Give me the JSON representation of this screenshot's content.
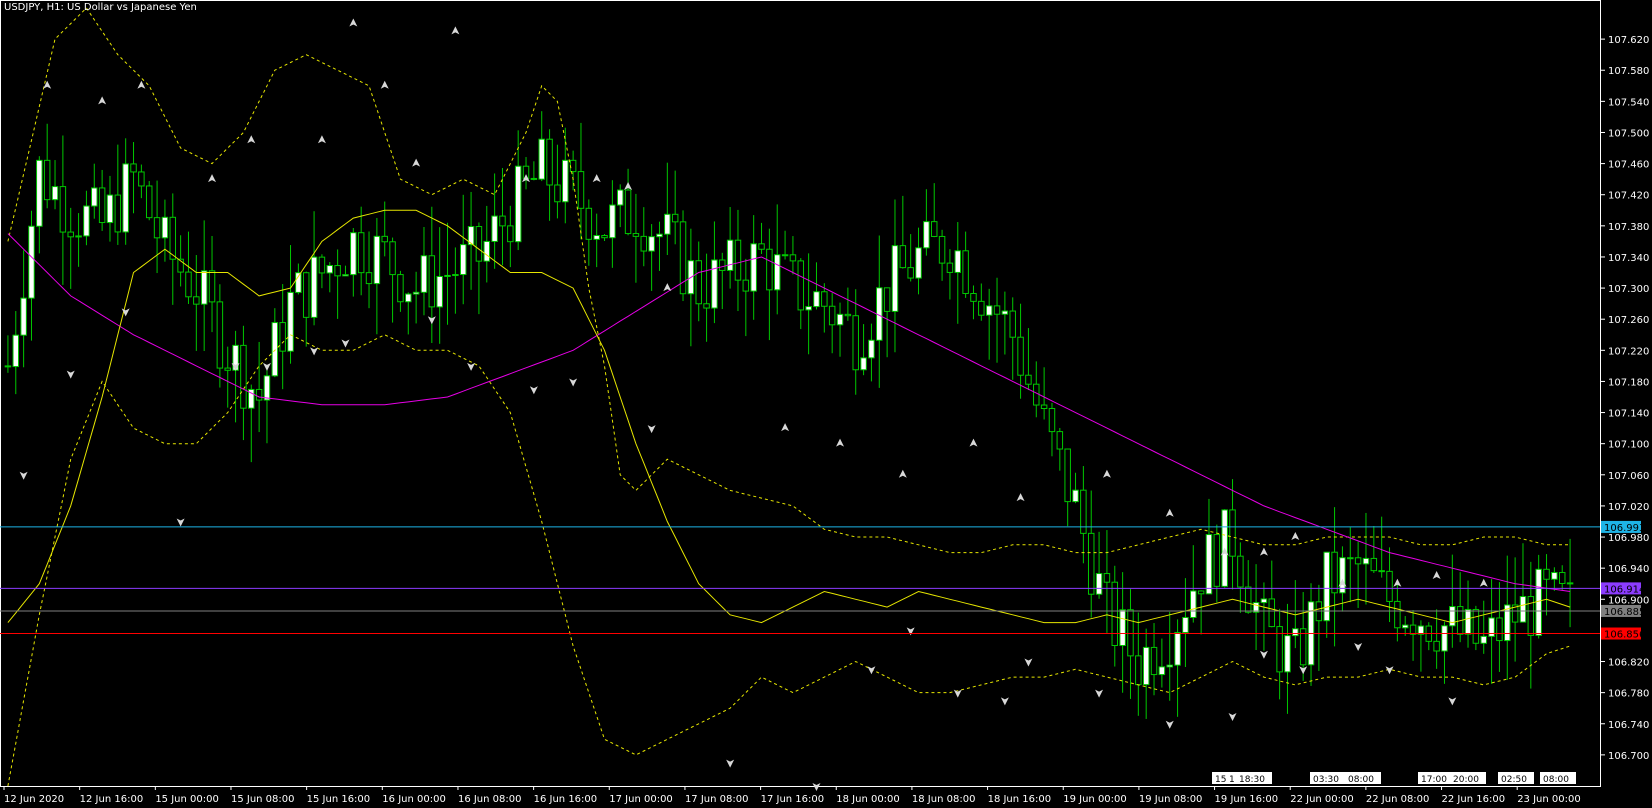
{
  "window": {
    "title": "USDJPY, H1:  US Dollar vs Japanese Yen"
  },
  "colors": {
    "background": "#000000",
    "bull_body": "#ffffff",
    "candle_line": "#00c800",
    "bear_body": "#000000",
    "fast_ma": "#e6e600",
    "slow_ma": "#e600e6",
    "bands": "#e6e600",
    "line_blue": "#1eb4e6",
    "line_purple": "#8c3cff",
    "line_gray": "#808080",
    "line_red": "#ff0000",
    "axis": "#ffffff"
  },
  "chart_data": {
    "type": "candlestick",
    "symbol": "USDJPY",
    "timeframe": "H1",
    "ylim": [
      106.66,
      107.66
    ],
    "y_ticks": [
      "107.620",
      "107.580",
      "107.540",
      "107.500",
      "107.460",
      "107.420",
      "107.380",
      "107.340",
      "107.300",
      "107.260",
      "107.220",
      "107.180",
      "107.140",
      "107.100",
      "107.060",
      "107.020",
      "106.980",
      "106.940",
      "106.900",
      "106.820",
      "106.780",
      "106.740",
      "106.700"
    ],
    "x_ticks": [
      "12 Jun 2020",
      "12 Jun 16:00",
      "15 Jun 00:00",
      "15 Jun 08:00",
      "15 Jun 16:00",
      "16 Jun 00:00",
      "16 Jun 08:00",
      "16 Jun 16:00",
      "17 Jun 00:00",
      "17 Jun 08:00",
      "17 Jun 16:00",
      "18 Jun 00:00",
      "18 Jun 08:00",
      "18 Jun 16:00",
      "19 Jun 00:00",
      "19 Jun 08:00",
      "19 Jun 16:00",
      "22 Jun 00:00",
      "22 Jun 08:00",
      "22 Jun 16:00",
      "23 Jun 00:00"
    ],
    "bar_count": 200,
    "horizontal_lines": [
      {
        "value": 106.993,
        "label": "106.993",
        "color": "#1eb4e6"
      },
      {
        "value": 106.914,
        "label": "106.914",
        "color": "#8c3cff"
      },
      {
        "value": 106.885,
        "label": "106.885",
        "color": "#808080"
      },
      {
        "value": 106.856,
        "label": "106.856",
        "color": "#ff0000"
      }
    ],
    "price_path": [
      [
        0,
        107.2
      ],
      [
        4,
        107.45
      ],
      [
        8,
        107.4
      ],
      [
        12,
        107.38
      ],
      [
        16,
        107.44
      ],
      [
        20,
        107.35
      ],
      [
        24,
        107.3
      ],
      [
        28,
        107.22
      ],
      [
        32,
        107.16
      ],
      [
        36,
        107.28
      ],
      [
        40,
        107.32
      ],
      [
        44,
        107.36
      ],
      [
        48,
        107.34
      ],
      [
        52,
        107.3
      ],
      [
        56,
        107.32
      ],
      [
        60,
        107.34
      ],
      [
        64,
        107.4
      ],
      [
        68,
        107.45
      ],
      [
        72,
        107.42
      ],
      [
        76,
        107.38
      ],
      [
        80,
        107.4
      ],
      [
        84,
        107.36
      ],
      [
        88,
        107.3
      ],
      [
        92,
        107.32
      ],
      [
        96,
        107.34
      ],
      [
        100,
        107.3
      ],
      [
        104,
        107.28
      ],
      [
        108,
        107.24
      ],
      [
        112,
        107.3
      ],
      [
        116,
        107.34
      ],
      [
        120,
        107.36
      ],
      [
        124,
        107.3
      ],
      [
        128,
        107.24
      ],
      [
        132,
        107.12
      ],
      [
        136,
        107.02
      ],
      [
        140,
        106.88
      ],
      [
        144,
        106.82
      ],
      [
        148,
        106.86
      ],
      [
        152,
        106.94
      ],
      [
        156,
        106.98
      ],
      [
        160,
        106.86
      ],
      [
        164,
        106.82
      ],
      [
        168,
        106.92
      ],
      [
        172,
        106.94
      ],
      [
        176,
        106.9
      ],
      [
        180,
        106.88
      ],
      [
        184,
        106.86
      ],
      [
        188,
        106.84
      ],
      [
        192,
        106.88
      ],
      [
        196,
        106.9
      ],
      [
        199,
        106.89
      ]
    ],
    "fast_ma_path": [
      [
        0,
        106.87
      ],
      [
        4,
        106.92
      ],
      [
        8,
        107.02
      ],
      [
        12,
        107.16
      ],
      [
        16,
        107.32
      ],
      [
        20,
        107.35
      ],
      [
        24,
        107.32
      ],
      [
        28,
        107.32
      ],
      [
        32,
        107.29
      ],
      [
        36,
        107.3
      ],
      [
        40,
        107.36
      ],
      [
        44,
        107.39
      ],
      [
        48,
        107.4
      ],
      [
        52,
        107.4
      ],
      [
        56,
        107.38
      ],
      [
        60,
        107.35
      ],
      [
        64,
        107.32
      ],
      [
        68,
        107.32
      ],
      [
        72,
        107.3
      ],
      [
        76,
        107.22
      ],
      [
        80,
        107.1
      ],
      [
        84,
        107.0
      ],
      [
        88,
        106.92
      ],
      [
        92,
        106.88
      ],
      [
        96,
        106.87
      ],
      [
        100,
        106.89
      ],
      [
        104,
        106.91
      ],
      [
        108,
        106.9
      ],
      [
        112,
        106.89
      ],
      [
        116,
        106.91
      ],
      [
        120,
        106.9
      ],
      [
        124,
        106.89
      ],
      [
        128,
        106.88
      ],
      [
        132,
        106.87
      ],
      [
        136,
        106.87
      ],
      [
        140,
        106.88
      ],
      [
        144,
        106.87
      ],
      [
        148,
        106.88
      ],
      [
        152,
        106.89
      ],
      [
        156,
        106.9
      ],
      [
        160,
        106.89
      ],
      [
        164,
        106.88
      ],
      [
        168,
        106.89
      ],
      [
        172,
        106.9
      ],
      [
        176,
        106.89
      ],
      [
        180,
        106.88
      ],
      [
        184,
        106.87
      ],
      [
        188,
        106.88
      ],
      [
        192,
        106.89
      ],
      [
        196,
        106.9
      ],
      [
        199,
        106.89
      ]
    ],
    "slow_ma_path": [
      [
        0,
        107.37
      ],
      [
        8,
        107.29
      ],
      [
        16,
        107.24
      ],
      [
        24,
        107.2
      ],
      [
        32,
        107.16
      ],
      [
        40,
        107.15
      ],
      [
        48,
        107.15
      ],
      [
        56,
        107.16
      ],
      [
        64,
        107.19
      ],
      [
        72,
        107.22
      ],
      [
        80,
        107.27
      ],
      [
        88,
        107.32
      ],
      [
        96,
        107.34
      ],
      [
        104,
        107.3
      ],
      [
        112,
        107.26
      ],
      [
        120,
        107.22
      ],
      [
        128,
        107.18
      ],
      [
        136,
        107.14
      ],
      [
        144,
        107.1
      ],
      [
        152,
        107.06
      ],
      [
        160,
        107.02
      ],
      [
        168,
        106.99
      ],
      [
        176,
        106.96
      ],
      [
        184,
        106.94
      ],
      [
        192,
        106.92
      ],
      [
        199,
        106.91
      ]
    ],
    "upper_band_path": [
      [
        0,
        107.36
      ],
      [
        6,
        107.62
      ],
      [
        10,
        107.66
      ],
      [
        14,
        107.6
      ],
      [
        18,
        107.56
      ],
      [
        22,
        107.48
      ],
      [
        26,
        107.46
      ],
      [
        30,
        107.5
      ],
      [
        34,
        107.58
      ],
      [
        38,
        107.6
      ],
      [
        42,
        107.58
      ],
      [
        46,
        107.56
      ],
      [
        50,
        107.44
      ],
      [
        54,
        107.42
      ],
      [
        58,
        107.44
      ],
      [
        62,
        107.42
      ],
      [
        66,
        107.5
      ],
      [
        68,
        107.56
      ],
      [
        70,
        107.54
      ],
      [
        72,
        107.44
      ],
      [
        74,
        107.3
      ],
      [
        76,
        107.2
      ],
      [
        78,
        107.06
      ],
      [
        80,
        107.04
      ],
      [
        84,
        107.08
      ],
      [
        88,
        107.06
      ],
      [
        92,
        107.04
      ],
      [
        96,
        107.03
      ],
      [
        100,
        107.02
      ],
      [
        104,
        106.99
      ],
      [
        108,
        106.98
      ],
      [
        112,
        106.98
      ],
      [
        116,
        106.97
      ],
      [
        120,
        106.96
      ],
      [
        124,
        106.96
      ],
      [
        128,
        106.97
      ],
      [
        132,
        106.97
      ],
      [
        136,
        106.96
      ],
      [
        140,
        106.96
      ],
      [
        144,
        106.97
      ],
      [
        148,
        106.98
      ],
      [
        152,
        106.99
      ],
      [
        156,
        106.98
      ],
      [
        160,
        106.97
      ],
      [
        164,
        106.97
      ],
      [
        168,
        106.98
      ],
      [
        172,
        106.98
      ],
      [
        176,
        106.98
      ],
      [
        180,
        106.97
      ],
      [
        184,
        106.97
      ],
      [
        188,
        106.98
      ],
      [
        192,
        106.98
      ],
      [
        196,
        106.97
      ],
      [
        199,
        106.97
      ]
    ],
    "lower_band_path": [
      [
        0,
        106.66
      ],
      [
        4,
        106.88
      ],
      [
        8,
        107.08
      ],
      [
        12,
        107.18
      ],
      [
        16,
        107.12
      ],
      [
        20,
        107.1
      ],
      [
        24,
        107.1
      ],
      [
        28,
        107.14
      ],
      [
        32,
        107.2
      ],
      [
        36,
        107.24
      ],
      [
        40,
        107.22
      ],
      [
        44,
        107.22
      ],
      [
        48,
        107.24
      ],
      [
        52,
        107.22
      ],
      [
        56,
        107.22
      ],
      [
        60,
        107.2
      ],
      [
        64,
        107.14
      ],
      [
        68,
        107.0
      ],
      [
        72,
        106.84
      ],
      [
        76,
        106.72
      ],
      [
        80,
        106.7
      ],
      [
        84,
        106.72
      ],
      [
        88,
        106.74
      ],
      [
        92,
        106.76
      ],
      [
        96,
        106.8
      ],
      [
        100,
        106.78
      ],
      [
        104,
        106.8
      ],
      [
        108,
        106.82
      ],
      [
        112,
        106.8
      ],
      [
        116,
        106.78
      ],
      [
        120,
        106.78
      ],
      [
        124,
        106.79
      ],
      [
        128,
        106.8
      ],
      [
        132,
        106.8
      ],
      [
        136,
        106.81
      ],
      [
        140,
        106.8
      ],
      [
        144,
        106.79
      ],
      [
        148,
        106.78
      ],
      [
        152,
        106.8
      ],
      [
        156,
        106.82
      ],
      [
        160,
        106.8
      ],
      [
        164,
        106.79
      ],
      [
        168,
        106.8
      ],
      [
        172,
        106.8
      ],
      [
        176,
        106.81
      ],
      [
        180,
        106.8
      ],
      [
        184,
        106.8
      ],
      [
        188,
        106.79
      ],
      [
        192,
        106.8
      ],
      [
        196,
        106.83
      ],
      [
        199,
        106.84
      ]
    ],
    "fractals_up": [
      [
        5,
        107.56
      ],
      [
        12,
        107.54
      ],
      [
        17,
        107.56
      ],
      [
        26,
        107.44
      ],
      [
        31,
        107.49
      ],
      [
        40,
        107.49
      ],
      [
        44,
        107.64
      ],
      [
        48,
        107.56
      ],
      [
        52,
        107.46
      ],
      [
        57,
        107.63
      ],
      [
        66,
        107.44
      ],
      [
        75,
        107.44
      ],
      [
        79,
        107.43
      ],
      [
        84,
        107.3
      ],
      [
        99,
        107.12
      ],
      [
        106,
        107.1
      ],
      [
        114,
        107.06
      ],
      [
        123,
        107.1
      ],
      [
        129,
        107.03
      ],
      [
        140,
        107.06
      ],
      [
        148,
        107.01
      ],
      [
        155,
        106.96
      ],
      [
        160,
        106.96
      ],
      [
        164,
        106.98
      ],
      [
        170,
        106.92
      ],
      [
        177,
        106.92
      ],
      [
        182,
        106.93
      ],
      [
        188,
        106.92
      ]
    ],
    "fractals_down": [
      [
        2,
        107.06
      ],
      [
        8,
        107.19
      ],
      [
        15,
        107.27
      ],
      [
        22,
        107.0
      ],
      [
        29,
        107.2
      ],
      [
        33,
        107.2
      ],
      [
        39,
        107.22
      ],
      [
        43,
        107.23
      ],
      [
        54,
        107.26
      ],
      [
        59,
        107.2
      ],
      [
        67,
        107.17
      ],
      [
        72,
        107.18
      ],
      [
        82,
        107.12
      ],
      [
        92,
        106.69
      ],
      [
        103,
        106.66
      ],
      [
        110,
        106.81
      ],
      [
        115,
        106.86
      ],
      [
        121,
        106.78
      ],
      [
        127,
        106.77
      ],
      [
        130,
        106.82
      ],
      [
        139,
        106.78
      ],
      [
        148,
        106.74
      ],
      [
        156,
        106.75
      ],
      [
        160,
        106.83
      ],
      [
        165,
        106.81
      ],
      [
        172,
        106.84
      ],
      [
        176,
        106.81
      ],
      [
        184,
        106.77
      ]
    ],
    "time_labels_bottom": [
      "15:",
      "1",
      "18:30",
      "03:30",
      "08:00",
      "17:00",
      "20:00",
      "02:50",
      "08:00"
    ]
  }
}
